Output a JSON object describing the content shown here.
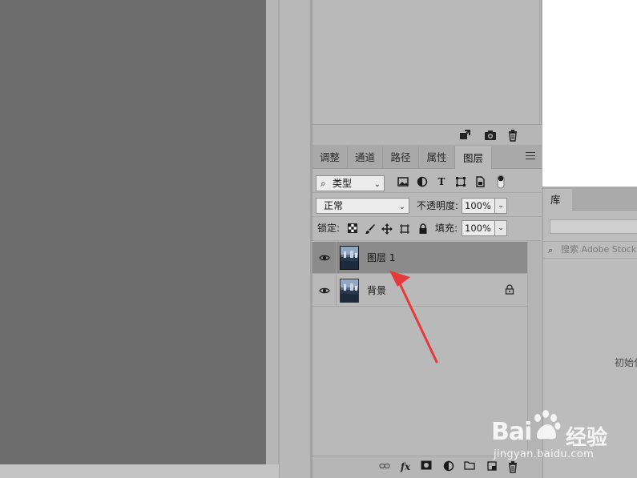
{
  "history_panel": {
    "footer_icons": [
      "new-snapshot-icon",
      "camera-icon",
      "trash-icon"
    ]
  },
  "layers_panel": {
    "tabs": [
      {
        "label": "调整"
      },
      {
        "label": "通道"
      },
      {
        "label": "路径"
      },
      {
        "label": "属性"
      },
      {
        "label": "图层"
      }
    ],
    "active_tab": "图层",
    "filter": {
      "kind_label": "类型",
      "filter_icons": [
        "image-filter-icon",
        "adjustment-filter-icon",
        "type-filter-icon",
        "shape-filter-icon",
        "smart-object-filter-icon",
        "filter-toggle-icon"
      ]
    },
    "blend_mode": "正常",
    "opacity_label": "不透明度:",
    "opacity_value": "100%",
    "lock_label": "锁定:",
    "fill_label": "填充:",
    "fill_value": "100%",
    "layers": [
      {
        "name": "图层 1",
        "selected": true,
        "visible": true,
        "locked": false
      },
      {
        "name": "背景",
        "selected": false,
        "visible": true,
        "locked": true
      }
    ],
    "footer_icons": [
      "link-icon",
      "fx-icon",
      "mask-icon",
      "adjustment-icon",
      "folder-icon",
      "new-layer-icon",
      "trash-icon"
    ]
  },
  "library_panel": {
    "tab_label": "库",
    "search_placeholder": "搜索 Adobe Stock",
    "body_text": "初始化"
  },
  "watermark": {
    "brand": "Bai",
    "brand_cn": "经验",
    "url": "jingyan.baidu.com"
  },
  "colors": {
    "canvas": "#6d6d6d",
    "panel": "#b9b9b9",
    "selected_layer": "#8b8b8b",
    "annotation_arrow": "#e8393a"
  }
}
